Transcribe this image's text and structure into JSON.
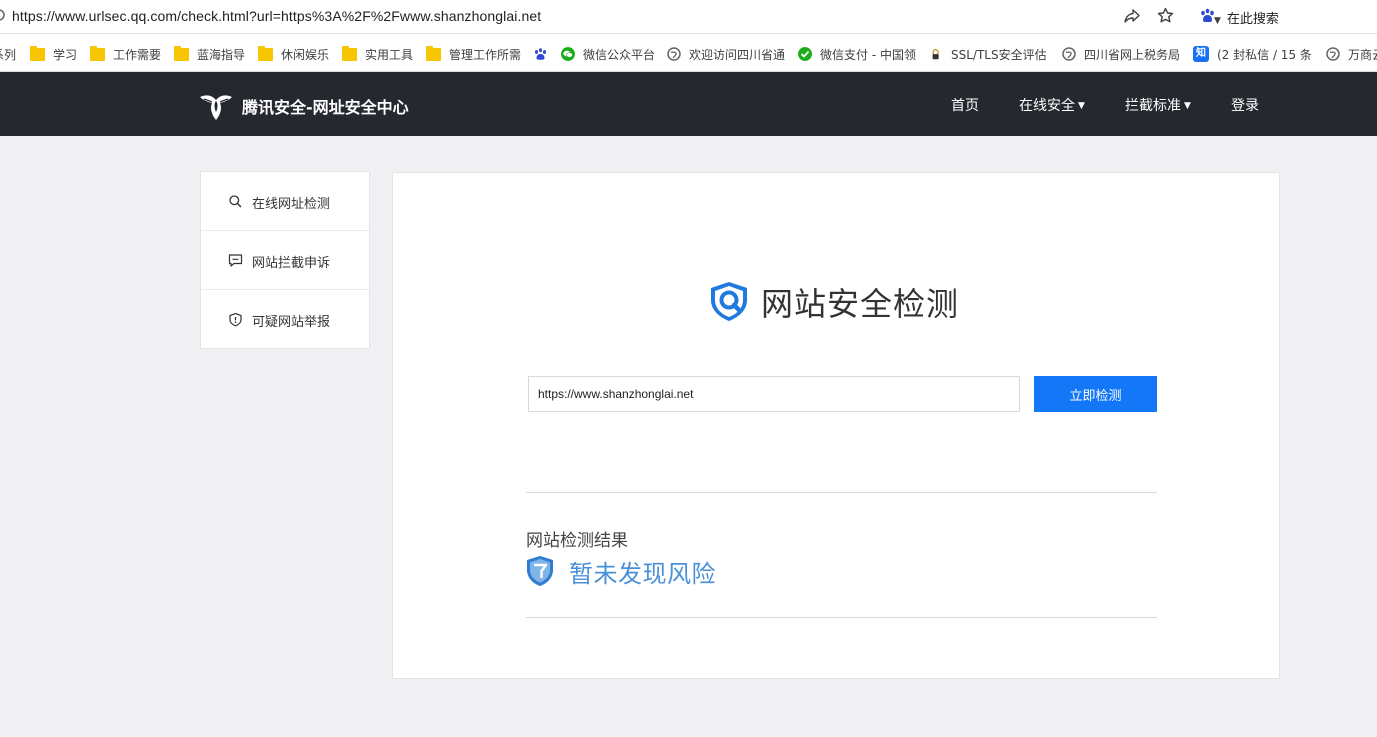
{
  "browser": {
    "url": "https://www.urlsec.qq.com/check.html?url=https%3A%2F%2Fwww.shanzhonglai.net",
    "search_engine_label": "在此搜索"
  },
  "bookmarks": [
    {
      "label": "系列",
      "icon": "none"
    },
    {
      "label": "学习",
      "icon": "folder"
    },
    {
      "label": "工作需要",
      "icon": "folder"
    },
    {
      "label": "蓝海指导",
      "icon": "folder"
    },
    {
      "label": "休闲娱乐",
      "icon": "folder"
    },
    {
      "label": "实用工具",
      "icon": "folder"
    },
    {
      "label": "管理工作所需",
      "icon": "folder"
    },
    {
      "label": "",
      "icon": "baidu-paw"
    },
    {
      "label": "微信公众平台",
      "icon": "wechat"
    },
    {
      "label": "欢迎访问四川省通",
      "icon": "globe"
    },
    {
      "label": "微信支付 - 中国领",
      "icon": "wechat-pay"
    },
    {
      "label": "SSL/TLS安全评估",
      "icon": "ssl"
    },
    {
      "label": "四川省网上税务局",
      "icon": "globe"
    },
    {
      "label": "(2 封私信 / 15 条",
      "icon": "zhihu"
    },
    {
      "label": "万商云",
      "icon": "globe"
    }
  ],
  "header": {
    "brand": "腾讯安全-网址安全中心",
    "nav": {
      "home": "首页",
      "online_security": "在线安全",
      "block_standard": "拦截标准",
      "login": "登录"
    }
  },
  "sidebar": {
    "items": [
      {
        "label": "在线网址检测",
        "icon": "search-icon"
      },
      {
        "label": "网站拦截申诉",
        "icon": "chat-icon"
      },
      {
        "label": "可疑网站举报",
        "icon": "shield-icon"
      }
    ]
  },
  "main": {
    "title": "网站安全检测",
    "input_value": "https://www.shanzhonglai.net",
    "button_label": "立即检测",
    "result_label": "网站检测结果",
    "result_text": "暂未发现风险"
  },
  "colors": {
    "header_bg": "#262830",
    "accent_blue": "#1377f7",
    "result_blue": "#4a90d9",
    "page_bg": "#f0f0f3"
  }
}
